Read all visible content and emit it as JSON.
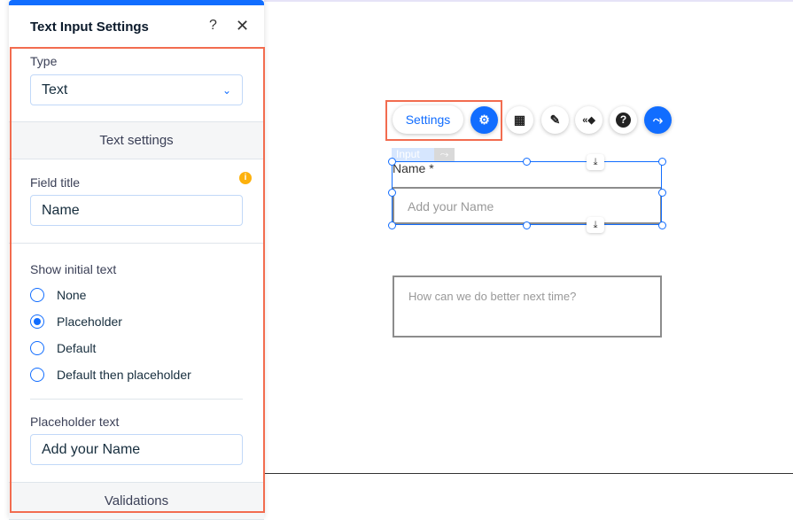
{
  "panel": {
    "title": "Text Input Settings",
    "help": "?",
    "close": "✕",
    "type": {
      "label": "Type",
      "value": "Text"
    },
    "text_settings": "Text settings",
    "field_title": {
      "label": "Field title",
      "value": "Name",
      "info": "i"
    },
    "show_initial": {
      "label": "Show initial text",
      "options": [
        "None",
        "Placeholder",
        "Default",
        "Default then placeholder"
      ],
      "selected": "Placeholder"
    },
    "placeholder": {
      "label": "Placeholder text",
      "value": "Add your Name"
    },
    "validations": "Validations"
  },
  "canvas": {
    "toolbar": {
      "settings_label": "Settings",
      "icons": [
        "gear-icon",
        "layout-icon",
        "design-brush-icon",
        "animation-icon",
        "help-icon",
        "connect-icon"
      ]
    },
    "tag": "Input",
    "field_label": "Name *",
    "field_placeholder": "Add your Name",
    "textarea_placeholder": "How can we do better next time?"
  },
  "colors": {
    "accent": "#116dff",
    "highlight": "#f26c4f",
    "info": "#fdb10c"
  }
}
